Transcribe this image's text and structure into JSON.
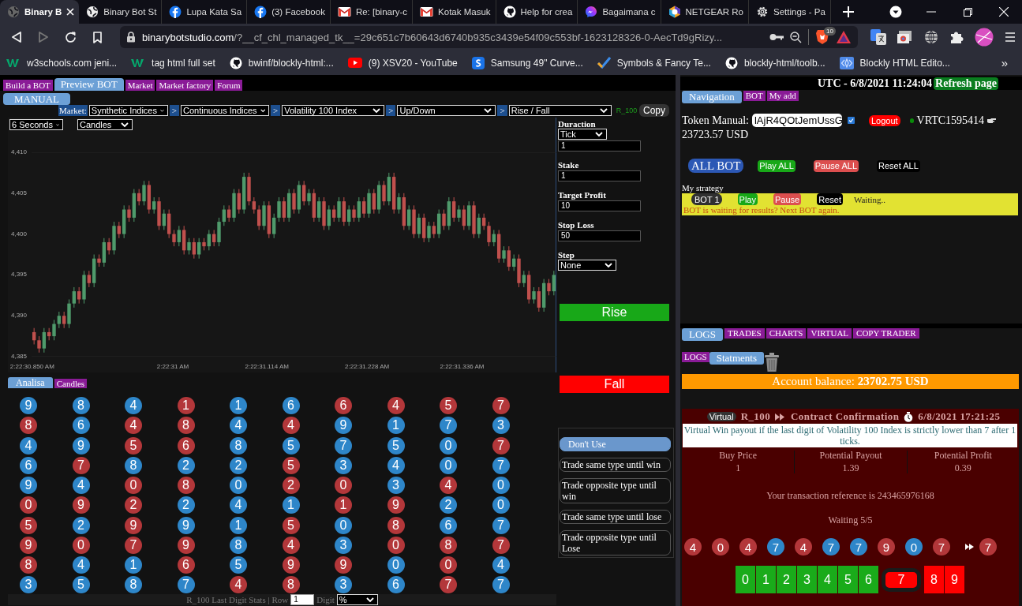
{
  "browser": {
    "tabs": [
      {
        "title": "Binary B",
        "kind": "web",
        "selected": true
      },
      {
        "title": "Binary Bot St",
        "kind": "web",
        "selected": false
      },
      {
        "title": "Lupa Kata Sa",
        "kind": "social",
        "selected": false
      },
      {
        "title": "(3) Facebook",
        "kind": "social",
        "selected": false
      },
      {
        "title": "Re: [binary-c",
        "kind": "mail",
        "selected": false
      },
      {
        "title": "Kotak Masuk",
        "kind": "mail",
        "selected": false
      },
      {
        "title": "Help for crea",
        "kind": "code",
        "selected": false
      },
      {
        "title": "Bagaimana c",
        "kind": "chat",
        "selected": false
      },
      {
        "title": "NETGEAR Ro",
        "kind": "router",
        "selected": false
      },
      {
        "title": "Settings - Pa",
        "kind": "settings",
        "selected": false
      }
    ],
    "url_host": "binarybotstudio.com",
    "url_path": "/?__cf_chl_managed_tk__=29c651c7b60643d6740b935c3439e54f09c553bf-1623128326-0-AecTd9gRizy...",
    "shield_count": "10",
    "bookmarks": [
      {
        "title": "w3schools.com jeni...",
        "kind": "school"
      },
      {
        "title": "tag html full set",
        "kind": "school"
      },
      {
        "title": "bwinf/blockly-html:...",
        "kind": "code"
      },
      {
        "title": "(9) XSV20 - YouTube",
        "kind": "video"
      },
      {
        "title": "Samsung 49\" Curve...",
        "kind": "store"
      },
      {
        "title": "Symbols & Fancy Te...",
        "kind": "check"
      },
      {
        "title": "blockly-html/toolb...",
        "kind": "code"
      },
      {
        "title": "Blockly HTML Edito...",
        "kind": "blocks"
      }
    ],
    "more": "»"
  },
  "top_nav": [
    {
      "label": "Build a BOT",
      "selected": false
    },
    {
      "label": "Preview BOT",
      "selected": true
    },
    {
      "label": "Market",
      "selected": false
    },
    {
      "label": "Market factory",
      "selected": false
    },
    {
      "label": "Forum",
      "selected": false
    }
  ],
  "manual_tab": "MANUAL",
  "market": {
    "label": "Market:",
    "steps": [
      {
        "value": "Synthetic Indices"
      },
      {
        "sep": ">",
        "value": "Continuous Indices"
      },
      {
        "sep": ">",
        "value": "Volatility 100 Index"
      },
      {
        "sep": ">",
        "value": "Up/Down"
      },
      {
        "sep": ">",
        "value": "Rise / Fall"
      }
    ],
    "symbol": "R_100",
    "copy": "Copy"
  },
  "chart": {
    "interval": "6 Seconds",
    "style": "Candles",
    "chart_data": {
      "type": "candlestick",
      "ylim": [
        4385,
        4410
      ],
      "yticks": [
        {
          "value": 4410,
          "label": "4,410"
        },
        {
          "value": 4405,
          "label": "4,405"
        },
        {
          "value": 4400,
          "label": "4,400"
        },
        {
          "value": 4395,
          "label": "4,395"
        },
        {
          "value": 4390,
          "label": "4,390"
        },
        {
          "value": 4385,
          "label": "4,385"
        }
      ],
      "categories": [
        "2:22:30.850 AM",
        null,
        null,
        null,
        null,
        null,
        null,
        null,
        null,
        null,
        null,
        null,
        null,
        null,
        null,
        null,
        null,
        null,
        null,
        null,
        null,
        null,
        null,
        null,
        null,
        null,
        null,
        null,
        "2:22:31 AM",
        null,
        null,
        null,
        null,
        null,
        null,
        null,
        null,
        null,
        null,
        null,
        null,
        null,
        null,
        null,
        null,
        null,
        null,
        "2:22:31.114 AM",
        null,
        null,
        null,
        null,
        null,
        null,
        null,
        null,
        null,
        null,
        null,
        null,
        null,
        null,
        null,
        null,
        null,
        null,
        null,
        "2:22:31.228 AM",
        null,
        null,
        null,
        null,
        null,
        null,
        null,
        null,
        null,
        null,
        null,
        null,
        null,
        null,
        null,
        null,
        null,
        null,
        "2:22:31.336 AM",
        null,
        null,
        null,
        null,
        null,
        null,
        null,
        null,
        null,
        null,
        null,
        null,
        null,
        null,
        null,
        null,
        null,
        null
      ],
      "ohlc": [
        [
          4388,
          4388.5,
          4386.5,
          4387
        ],
        [
          4387,
          4387.5,
          4385.5,
          4386
        ],
        [
          4386,
          4388.5,
          4385.5,
          4388
        ],
        [
          4388,
          4388.5,
          4387,
          4387.5
        ],
        [
          4387.5,
          4389.5,
          4387,
          4389
        ],
        [
          4389,
          4390.5,
          4388.5,
          4390
        ],
        [
          4390,
          4390.5,
          4388.5,
          4389
        ],
        [
          4389,
          4392,
          4388.5,
          4391.5
        ],
        [
          4391.5,
          4393.5,
          4391,
          4393
        ],
        [
          4393,
          4393.5,
          4391.5,
          4392
        ],
        [
          4392,
          4395.5,
          4391.5,
          4395
        ],
        [
          4395,
          4395.5,
          4393.5,
          4394
        ],
        [
          4394,
          4397.5,
          4393.5,
          4397
        ],
        [
          4397,
          4397.5,
          4396,
          4396.5
        ],
        [
          4396.5,
          4399.5,
          4396,
          4399
        ],
        [
          4399,
          4399.5,
          4397.5,
          4398
        ],
        [
          4398,
          4401.5,
          4397.5,
          4401
        ],
        [
          4401,
          4401.5,
          4399.5,
          4400
        ],
        [
          4400,
          4403.5,
          4399.5,
          4403
        ],
        [
          4403,
          4403.5,
          4401.5,
          4402
        ],
        [
          4402,
          4405.5,
          4401.5,
          4405
        ],
        [
          4405,
          4405.5,
          4403.5,
          4404
        ],
        [
          4404,
          4406.5,
          4403.5,
          4406
        ],
        [
          4406,
          4406.5,
          4402.5,
          4403
        ],
        [
          4403,
          4404.5,
          4402.5,
          4404
        ],
        [
          4404,
          4404.5,
          4400.5,
          4401
        ],
        [
          4401,
          4403,
          4400.5,
          4402.5
        ],
        [
          4402.5,
          4403,
          4399.5,
          4400
        ],
        [
          4400,
          4400.5,
          4398.5,
          4399
        ],
        [
          4399,
          4401,
          4398.5,
          4400.5
        ],
        [
          4400.5,
          4401,
          4397.5,
          4398
        ],
        [
          4398,
          4399.5,
          4397.5,
          4399
        ],
        [
          4399,
          4399.5,
          4397,
          4397.5
        ],
        [
          4397.5,
          4399.5,
          4397,
          4399
        ],
        [
          4399,
          4399.5,
          4398,
          4398.5
        ],
        [
          4398.5,
          4400.5,
          4398,
          4400
        ],
        [
          4400,
          4400.5,
          4398.5,
          4399
        ],
        [
          4399,
          4402,
          4398.5,
          4401.5
        ],
        [
          4401.5,
          4403.5,
          4401,
          4403
        ],
        [
          4403,
          4403.5,
          4401.5,
          4402
        ],
        [
          4402,
          4405.5,
          4401.5,
          4405
        ],
        [
          4405,
          4405.5,
          4402.5,
          4403
        ],
        [
          4403,
          4407.5,
          4402.5,
          4407
        ],
        [
          4407,
          4407.5,
          4403.5,
          4404
        ],
        [
          4404,
          4404.5,
          4402.5,
          4403
        ],
        [
          4403,
          4403.5,
          4400.5,
          4401
        ],
        [
          4401,
          4404,
          4400.5,
          4403.5
        ],
        [
          4403.5,
          4404,
          4399.5,
          4400
        ],
        [
          4400,
          4402.5,
          4399.5,
          4402
        ],
        [
          4402,
          4404.5,
          4401.5,
          4404
        ],
        [
          4404,
          4404.5,
          4401.5,
          4402
        ],
        [
          4402,
          4405.5,
          4401.5,
          4405
        ],
        [
          4405,
          4405.5,
          4402.5,
          4403
        ],
        [
          4403,
          4406.5,
          4402.5,
          4406
        ],
        [
          4406,
          4406.5,
          4403.5,
          4404
        ],
        [
          4404,
          4405.5,
          4403.5,
          4405
        ],
        [
          4405,
          4405.5,
          4401.5,
          4402
        ],
        [
          4402,
          4404.5,
          4401.5,
          4404
        ],
        [
          4404,
          4404.5,
          4400.5,
          4401
        ],
        [
          4401,
          4403.5,
          4400.5,
          4403
        ],
        [
          4403,
          4403.5,
          4401.5,
          4402
        ],
        [
          4402,
          4404.5,
          4401.5,
          4404
        ],
        [
          4404,
          4404.5,
          4401,
          4401.5
        ],
        [
          4401.5,
          4403.5,
          4401,
          4403
        ],
        [
          4403,
          4403.5,
          4401.5,
          4402
        ],
        [
          4402,
          4404.5,
          4401.5,
          4404
        ],
        [
          4404,
          4404.5,
          4402,
          4402.5
        ],
        [
          4402.5,
          4405.5,
          4402,
          4405
        ],
        [
          4405,
          4405.5,
          4402.5,
          4403
        ],
        [
          4403,
          4406.5,
          4402.5,
          4406
        ],
        [
          4406,
          4406.5,
          4403.5,
          4404
        ],
        [
          4404,
          4407.5,
          4403.5,
          4407
        ],
        [
          4407,
          4407.5,
          4402.5,
          4403
        ],
        [
          4403,
          4405,
          4402.5,
          4404.5
        ],
        [
          4404.5,
          4405,
          4400.5,
          4401
        ],
        [
          4401,
          4403.5,
          4400.5,
          4403
        ],
        [
          4403,
          4403.5,
          4399.5,
          4400
        ],
        [
          4400,
          4402.5,
          4399.5,
          4402
        ],
        [
          4402,
          4402.5,
          4399,
          4399.5
        ],
        [
          4399.5,
          4401.5,
          4399,
          4401
        ],
        [
          4401,
          4401.5,
          4399.5,
          4400
        ],
        [
          4400,
          4403,
          4399.5,
          4402.5
        ],
        [
          4402.5,
          4403,
          4400.5,
          4401
        ],
        [
          4401,
          4404.5,
          4400.5,
          4404
        ],
        [
          4404,
          4404.5,
          4401.5,
          4402
        ],
        [
          4402,
          4403.5,
          4401.5,
          4403
        ],
        [
          4403,
          4403.5,
          4400.5,
          4401
        ],
        [
          4401,
          4404,
          4400.5,
          4403.5
        ],
        [
          4403.5,
          4404,
          4399.5,
          4400
        ],
        [
          4400,
          4402.5,
          4399.5,
          4402
        ],
        [
          4402,
          4402.5,
          4400.5,
          4401
        ],
        [
          4401,
          4401.5,
          4398.5,
          4399
        ],
        [
          4399,
          4400.5,
          4398.5,
          4400
        ],
        [
          4400,
          4400.5,
          4396.5,
          4397
        ],
        [
          4397,
          4398.5,
          4396.5,
          4398
        ],
        [
          4398,
          4398.5,
          4395.5,
          4396
        ],
        [
          4396,
          4397.5,
          4395.5,
          4397
        ],
        [
          4397,
          4397.5,
          4393.5,
          4394
        ],
        [
          4394,
          4395.5,
          4393.5,
          4395
        ],
        [
          4395,
          4395.5,
          4391.5,
          4392
        ],
        [
          4392,
          4393.5,
          4391.5,
          4393
        ],
        [
          4393,
          4393.5,
          4390.5,
          4391
        ],
        [
          4391,
          4394.5,
          4390.5,
          4394
        ],
        [
          4394,
          4394.5,
          4392.5,
          4393
        ],
        [
          4393,
          4395.5,
          4392.5,
          4395
        ]
      ]
    }
  },
  "trade_form": [
    {
      "kind": "select",
      "label": "Duraction",
      "value": "Tick"
    },
    {
      "kind": "input",
      "value": "1"
    },
    {
      "kind": "input",
      "label": "Stake",
      "value": "1"
    },
    {
      "kind": "input",
      "label": "Target Profit",
      "value": "10"
    },
    {
      "kind": "input",
      "label": "Stop Loss",
      "value": "50"
    },
    {
      "kind": "select",
      "label": "Step",
      "value": "None"
    }
  ],
  "rise_button": "Rise",
  "fall_button": "Fall",
  "strategy_options": [
    {
      "label": "Don't Use",
      "selected": true
    },
    {
      "label": "Trade same type until win",
      "selected": false
    },
    {
      "label": "Trade opposite type until win",
      "selected": false
    },
    {
      "label": "Trade same type until lose",
      "selected": false
    },
    {
      "label": "Trade opposite type until Lose",
      "selected": false
    }
  ],
  "analysis_tabs": [
    {
      "label": "Analisa",
      "selected": true
    },
    {
      "label": "Candles",
      "selected": false
    }
  ],
  "digit_grid": [
    [
      {
        "digit": "9",
        "color": "#2e86c9"
      },
      {
        "digit": "8",
        "color": "#2e86c9"
      },
      {
        "digit": "4",
        "color": "#2e86c9"
      },
      {
        "digit": "1",
        "color": "#b3373a"
      },
      {
        "digit": "1",
        "color": "#2e86c9"
      },
      {
        "digit": "6",
        "color": "#2e86c9"
      },
      {
        "digit": "6",
        "color": "#b3373a"
      },
      {
        "digit": "4",
        "color": "#b3373a"
      },
      {
        "digit": "5",
        "color": "#b3373a"
      },
      {
        "digit": "7",
        "color": "#b3373a"
      }
    ],
    [
      {
        "digit": "8",
        "color": "#b3373a"
      },
      {
        "digit": "6",
        "color": "#2e86c9"
      },
      {
        "digit": "4",
        "color": "#b3373a"
      },
      {
        "digit": "8",
        "color": "#b3373a"
      },
      {
        "digit": "4",
        "color": "#2e86c9"
      },
      {
        "digit": "4",
        "color": "#b3373a"
      },
      {
        "digit": "9",
        "color": "#2e86c9"
      },
      {
        "digit": "1",
        "color": "#2e86c9"
      },
      {
        "digit": "7",
        "color": "#2e86c9"
      },
      {
        "digit": "3",
        "color": "#2e86c9"
      }
    ],
    [
      {
        "digit": "4",
        "color": "#2e86c9"
      },
      {
        "digit": "9",
        "color": "#2e86c9"
      },
      {
        "digit": "5",
        "color": "#b3373a"
      },
      {
        "digit": "6",
        "color": "#b3373a"
      },
      {
        "digit": "8",
        "color": "#2e86c9"
      },
      {
        "digit": "5",
        "color": "#2e86c9"
      },
      {
        "digit": "7",
        "color": "#2e86c9"
      },
      {
        "digit": "5",
        "color": "#2e86c9"
      },
      {
        "digit": "0",
        "color": "#2e86c9"
      },
      {
        "digit": "7",
        "color": "#b3373a"
      }
    ],
    [
      {
        "digit": "6",
        "color": "#2e86c9"
      },
      {
        "digit": "7",
        "color": "#b3373a"
      },
      {
        "digit": "8",
        "color": "#2e86c9"
      },
      {
        "digit": "2",
        "color": "#2e86c9"
      },
      {
        "digit": "2",
        "color": "#2e86c9"
      },
      {
        "digit": "5",
        "color": "#b3373a"
      },
      {
        "digit": "3",
        "color": "#2e86c9"
      },
      {
        "digit": "4",
        "color": "#2e86c9"
      },
      {
        "digit": "0",
        "color": "#2e86c9"
      },
      {
        "digit": "7",
        "color": "#2e86c9"
      }
    ],
    [
      {
        "digit": "9",
        "color": "#2e86c9"
      },
      {
        "digit": "4",
        "color": "#2e86c9"
      },
      {
        "digit": "0",
        "color": "#b3373a"
      },
      {
        "digit": "8",
        "color": "#b3373a"
      },
      {
        "digit": "0",
        "color": "#2e86c9"
      },
      {
        "digit": "2",
        "color": "#b3373a"
      },
      {
        "digit": "0",
        "color": "#b3373a"
      },
      {
        "digit": "3",
        "color": "#2e86c9"
      },
      {
        "digit": "4",
        "color": "#b3373a"
      },
      {
        "digit": "0",
        "color": "#2e86c9"
      }
    ],
    [
      {
        "digit": "0",
        "color": "#b3373a"
      },
      {
        "digit": "9",
        "color": "#b3373a"
      },
      {
        "digit": "2",
        "color": "#b3373a"
      },
      {
        "digit": "2",
        "color": "#2e86c9"
      },
      {
        "digit": "4",
        "color": "#2e86c9"
      },
      {
        "digit": "1",
        "color": "#2e86c9"
      },
      {
        "digit": "1",
        "color": "#b3373a"
      },
      {
        "digit": "9",
        "color": "#b3373a"
      },
      {
        "digit": "2",
        "color": "#2e86c9"
      },
      {
        "digit": "0",
        "color": "#2e86c9"
      }
    ],
    [
      {
        "digit": "5",
        "color": "#b3373a"
      },
      {
        "digit": "2",
        "color": "#2e86c9"
      },
      {
        "digit": "9",
        "color": "#b3373a"
      },
      {
        "digit": "9",
        "color": "#2e86c9"
      },
      {
        "digit": "1",
        "color": "#2e86c9"
      },
      {
        "digit": "5",
        "color": "#b3373a"
      },
      {
        "digit": "0",
        "color": "#2e86c9"
      },
      {
        "digit": "8",
        "color": "#b3373a"
      },
      {
        "digit": "6",
        "color": "#2e86c9"
      },
      {
        "digit": "7",
        "color": "#2e86c9"
      }
    ],
    [
      {
        "digit": "9",
        "color": "#b3373a"
      },
      {
        "digit": "0",
        "color": "#b3373a"
      },
      {
        "digit": "7",
        "color": "#b3373a"
      },
      {
        "digit": "9",
        "color": "#b3373a"
      },
      {
        "digit": "8",
        "color": "#2e86c9"
      },
      {
        "digit": "4",
        "color": "#b3373a"
      },
      {
        "digit": "3",
        "color": "#2e86c9"
      },
      {
        "digit": "0",
        "color": "#b3373a"
      },
      {
        "digit": "8",
        "color": "#b3373a"
      },
      {
        "digit": "7",
        "color": "#b3373a"
      }
    ],
    [
      {
        "digit": "8",
        "color": "#b3373a"
      },
      {
        "digit": "4",
        "color": "#2e86c9"
      },
      {
        "digit": "1",
        "color": "#2e86c9"
      },
      {
        "digit": "6",
        "color": "#b3373a"
      },
      {
        "digit": "5",
        "color": "#2e86c9"
      },
      {
        "digit": "9",
        "color": "#b3373a"
      },
      {
        "digit": "9",
        "color": "#b3373a"
      },
      {
        "digit": "0",
        "color": "#2e86c9"
      },
      {
        "digit": "0",
        "color": "#b3373a"
      },
      {
        "digit": "4",
        "color": "#2e86c9"
      }
    ],
    [
      {
        "digit": "3",
        "color": "#2e86c9"
      },
      {
        "digit": "5",
        "color": "#2e86c9"
      },
      {
        "digit": "8",
        "color": "#2e86c9"
      },
      {
        "digit": "7",
        "color": "#2e86c9"
      },
      {
        "digit": "4",
        "color": "#b3373a"
      },
      {
        "digit": "8",
        "color": "#b3373a"
      },
      {
        "digit": "3",
        "color": "#2e86c9"
      },
      {
        "digit": "6",
        "color": "#2e86c9"
      },
      {
        "digit": "7",
        "color": "#b3373a"
      },
      {
        "digit": "7",
        "color": "#2e86c9"
      }
    ]
  ],
  "stats_bar": {
    "label": "R_100 Last Digit Stats | Row",
    "row": "1",
    "digit_label": "Digit",
    "digit_mode": "%"
  },
  "clock": "UTC - 6/8/2021 11:24:04",
  "refresh_button": "Refresh page",
  "nav_tabs": [
    {
      "label": "Navigation",
      "selected": true
    },
    {
      "label": "BOT",
      "selected": false
    },
    {
      "label": "My add",
      "selected": false
    }
  ],
  "token": {
    "label": "Token Manual:",
    "value": "lAjR4QOtJemUssG",
    "remember": true,
    "logout": "Logout",
    "online": true,
    "account": "VRTC1595414",
    "balance": "23723.57 USD"
  },
  "all_bot": {
    "title": "ALL BOT",
    "play": "Play ALL",
    "pause": "Pause ALL",
    "reset": "Reset ALL"
  },
  "strategy": {
    "heading": "My strategy",
    "bot": "BOT 1",
    "play": "Play",
    "pause": "Pause",
    "reset": "Reset",
    "status": "Waiting..",
    "message": "BOT is waiting for results? Next BOT again."
  },
  "log_tabs": [
    {
      "label": "LOGS",
      "selected": true
    },
    {
      "label": "TRADES",
      "selected": false
    },
    {
      "label": "CHARTS",
      "selected": false
    },
    {
      "label": "VIRTUAL",
      "selected": false
    },
    {
      "label": "COPY TRADER",
      "selected": false
    }
  ],
  "log_subtabs": [
    {
      "label": "LOGS",
      "selected": false
    },
    {
      "label": "Statments",
      "selected": true
    }
  ],
  "account_balance": "Account balance: **23702.75 USD**",
  "contract": {
    "badge": "Virtual",
    "symbol": "R_100",
    "title": "Contract Confirmation",
    "time": "6/8/2021 17:21:25",
    "description": "Virtual Win payout if the last digit of Volatility 100 Index is strictly lower than 7 after 1 ticks.",
    "stats": [
      {
        "label": "Buy Price",
        "value": "1"
      },
      {
        "label": "Potential Payout",
        "value": "1.39"
      },
      {
        "label": "Potential Profit",
        "value": "0.39"
      }
    ],
    "reference": "Your transaction reference is 243465976168",
    "waiting": "Waiting 5/5",
    "ticks": [
      {
        "digit": "4",
        "color": "#b3373a"
      },
      {
        "digit": "0",
        "color": "#b3373a"
      },
      {
        "digit": "4",
        "color": "#b3373a"
      },
      {
        "digit": "7",
        "color": "#2e86c9"
      },
      {
        "digit": "4",
        "color": "#b3373a"
      },
      {
        "digit": "7",
        "color": "#2e86c9"
      },
      {
        "digit": "7",
        "color": "#2e86c9"
      },
      {
        "digit": "9",
        "color": "#b3373a"
      },
      {
        "digit": "0",
        "color": "#2e86c9"
      },
      {
        "digit": "7",
        "color": "#b3373a"
      }
    ],
    "last_tick": {
      "digit": "7",
      "color": "#b3373a"
    },
    "digits": [
      {
        "digit": "0",
        "win": true,
        "selected": false
      },
      {
        "digit": "1",
        "win": true,
        "selected": false
      },
      {
        "digit": "2",
        "win": true,
        "selected": false
      },
      {
        "digit": "3",
        "win": true,
        "selected": false
      },
      {
        "digit": "4",
        "win": true,
        "selected": false
      },
      {
        "digit": "5",
        "win": true,
        "selected": false
      },
      {
        "digit": "6",
        "win": true,
        "selected": false
      },
      {
        "digit": "7",
        "win": false,
        "selected": true
      },
      {
        "digit": "8",
        "win": false,
        "selected": false
      },
      {
        "digit": "9",
        "win": false,
        "selected": false
      }
    ]
  }
}
